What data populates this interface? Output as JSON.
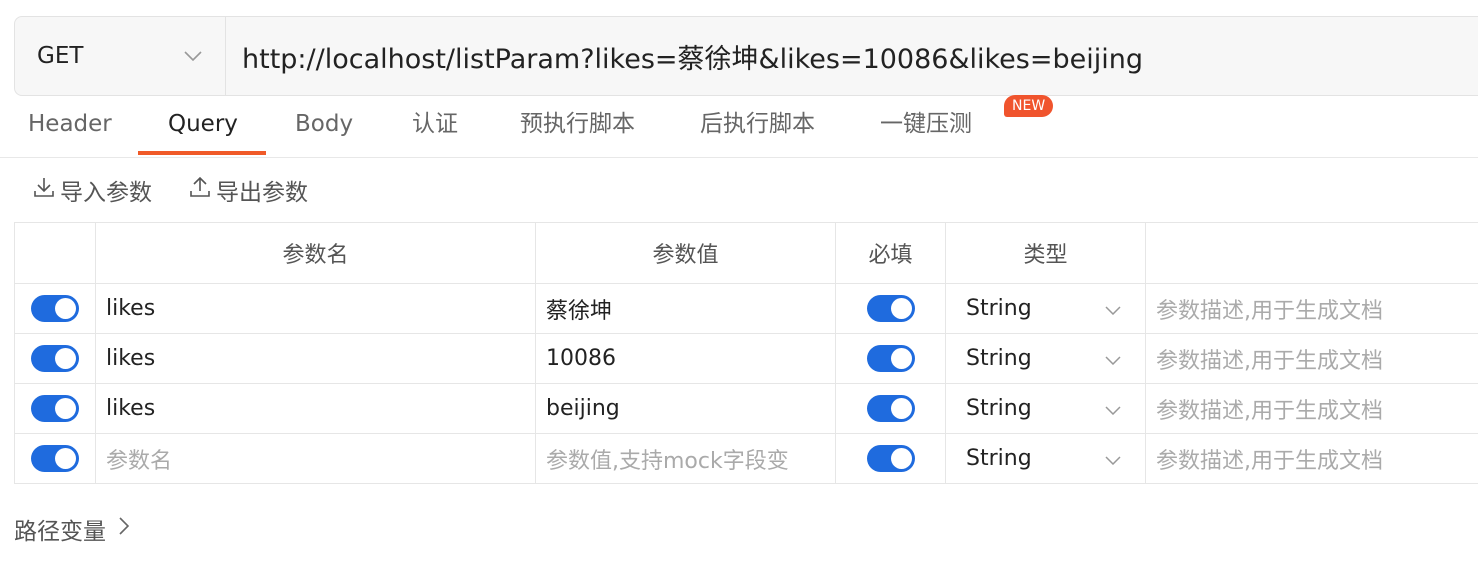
{
  "request": {
    "method": "GET",
    "url": "http://localhost/listParam?likes=蔡徐坤&likes=10086&likes=beijing"
  },
  "tabs": [
    {
      "label": "Header"
    },
    {
      "label": "Query",
      "active": true
    },
    {
      "label": "Body"
    },
    {
      "label": "认证"
    },
    {
      "label": "预执行脚本"
    },
    {
      "label": "后执行脚本"
    },
    {
      "label": "一键压测"
    }
  ],
  "badge": "NEW",
  "accent_color": "#f05a28",
  "toggle_color": "#1f6bde",
  "toolbar": {
    "import_label": "导入参数",
    "export_label": "导出参数"
  },
  "table": {
    "headers": [
      "参数名",
      "参数值",
      "必填",
      "类型"
    ],
    "rows": [
      {
        "enabled": true,
        "name": "likes",
        "value": "蔡徐坤",
        "required": true,
        "type": "String",
        "description_placeholder": "参数描述,用于生成文档"
      },
      {
        "enabled": true,
        "name": "likes",
        "value": "10086",
        "required": true,
        "type": "String",
        "description_placeholder": "参数描述,用于生成文档"
      },
      {
        "enabled": true,
        "name": "likes",
        "value": "beijing",
        "required": true,
        "type": "String",
        "description_placeholder": "参数描述,用于生成文档"
      }
    ],
    "new_row": {
      "enabled": true,
      "name_placeholder": "参数名",
      "value_placeholder": "参数值,支持mock字段变",
      "required": true,
      "type": "String",
      "description_placeholder": "参数描述,用于生成文档"
    }
  },
  "path_variables_label": "路径变量"
}
